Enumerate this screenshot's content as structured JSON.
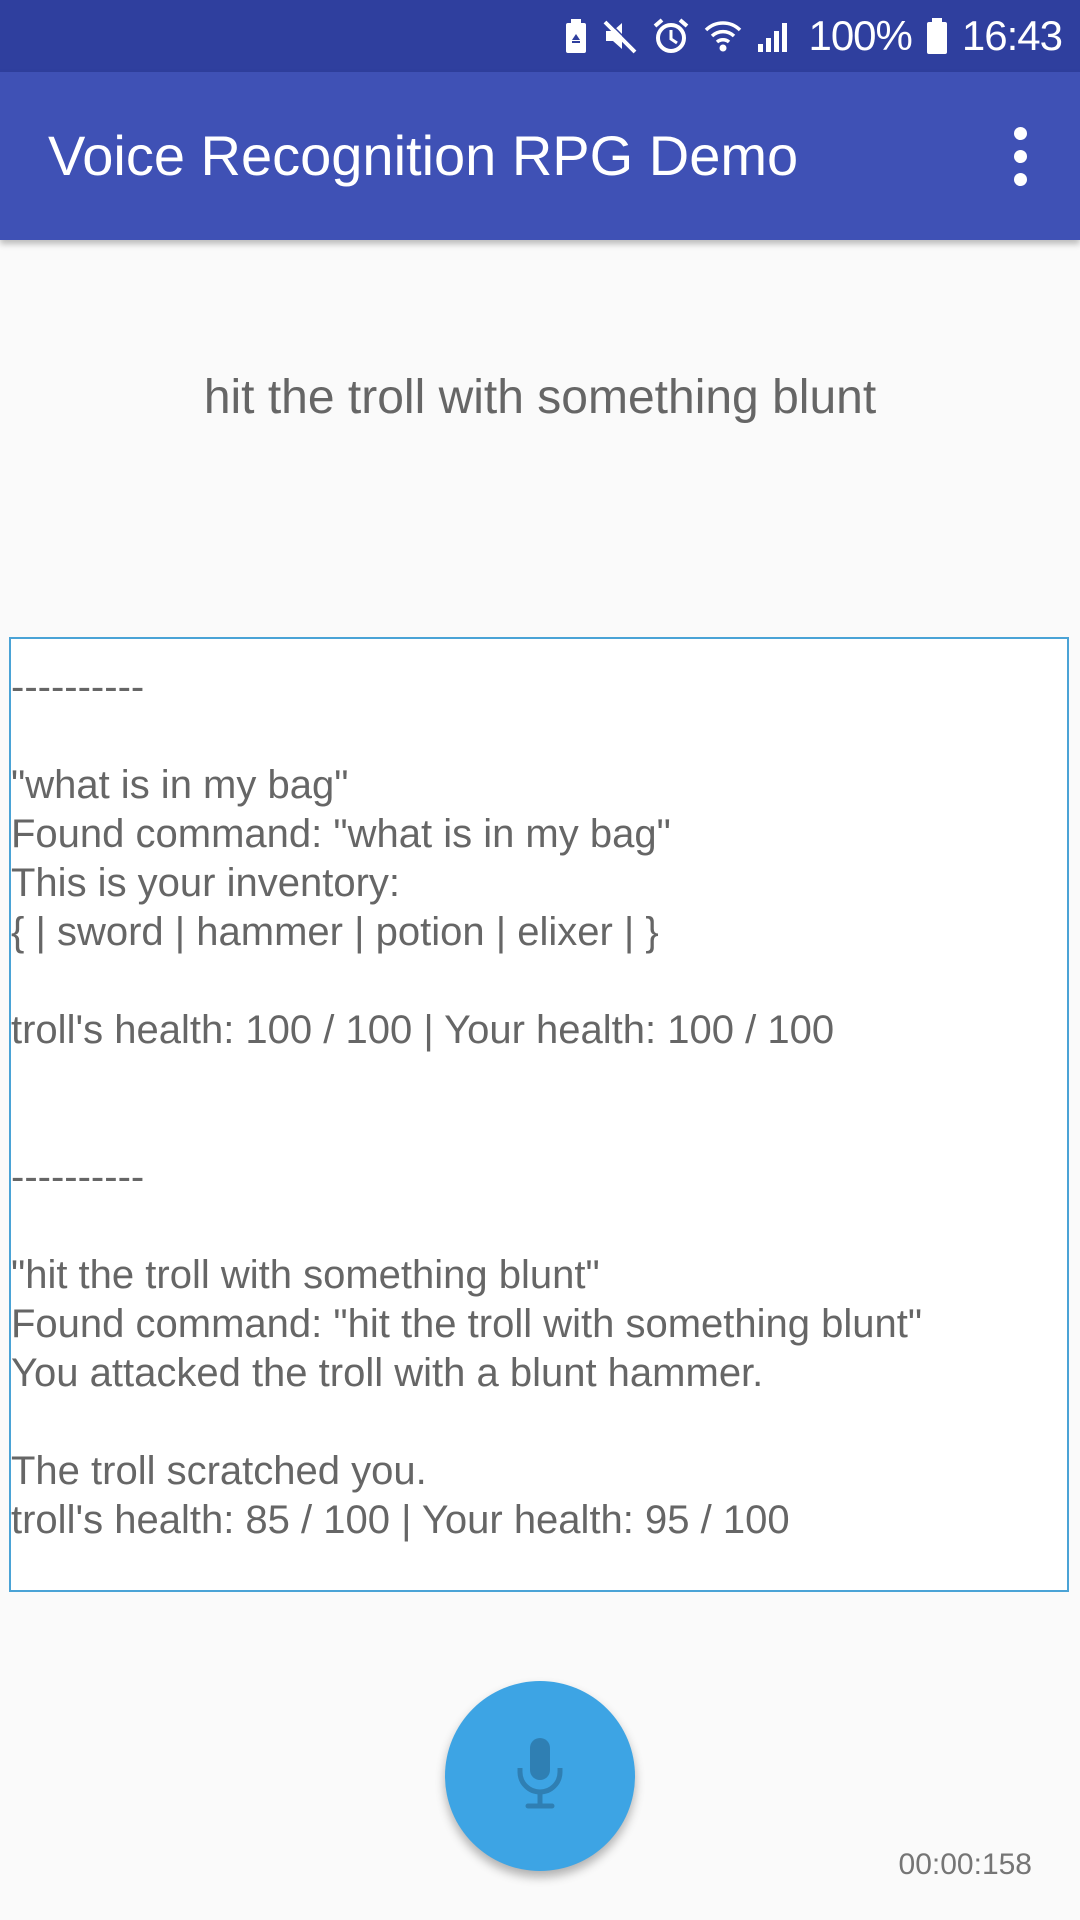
{
  "status_bar": {
    "battery_percent": "100%",
    "time": "16:43",
    "icons": [
      "battery-saver-icon",
      "mute-icon",
      "alarm-icon",
      "wifi-icon",
      "signal-icon",
      "battery-icon"
    ]
  },
  "app_bar": {
    "title": "Voice Recognition RPG Demo",
    "menu_icon": "more-vert-icon"
  },
  "recognized_text": "hit the troll with something blunt",
  "log": "----------\n\n\"what is in my bag\"\nFound command: \"what is in my bag\"\nThis is your inventory:\n{ | sword | hammer | potion | elixer | }\n\ntroll's health: 100 / 100 | Your health: 100 / 100\n\n\n----------\n\n\"hit the troll with something blunt\"\nFound command: \"hit the troll with something blunt\"\nYou attacked the troll with a blunt hammer.\n\nThe troll scratched you.\ntroll's health: 85 / 100 | Your health: 95 / 100",
  "mic_button": {
    "icon": "microphone-icon"
  },
  "timer": "00:00:158",
  "colors": {
    "status_bar": "#2f3f9e",
    "app_bar": "#3f51b5",
    "fab": "#3da4e4",
    "log_border": "#4aa3d6"
  }
}
